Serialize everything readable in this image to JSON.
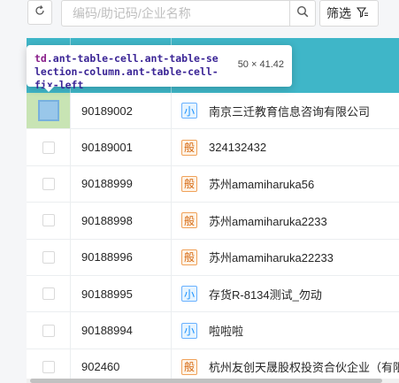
{
  "toolbar": {
    "search_placeholder": "编码/助记码/企业名称",
    "filter_label": "筛选",
    "icons": {
      "refresh": "refresh-icon",
      "search": "search-icon",
      "filter": "filter-icon"
    }
  },
  "table": {
    "header_color": "#3fb6c8",
    "rows": [
      {
        "code": "90189002",
        "tag": "小",
        "tag_type": "small",
        "name": "南京三迁教育信息咨询有限公司",
        "highlighted": true
      },
      {
        "code": "90189001",
        "tag": "般",
        "tag_type": "general",
        "name": "324132432"
      },
      {
        "code": "90188999",
        "tag": "般",
        "tag_type": "general",
        "name": "苏州amamiharuka56"
      },
      {
        "code": "90188998",
        "tag": "般",
        "tag_type": "general",
        "name": "苏州amamiharuka2233"
      },
      {
        "code": "90188996",
        "tag": "般",
        "tag_type": "general",
        "name": "苏州amamiharuka22233"
      },
      {
        "code": "90188995",
        "tag": "小",
        "tag_type": "small",
        "name": "存货R-8134测试_勿动"
      },
      {
        "code": "90188994",
        "tag": "小",
        "tag_type": "small",
        "name": "啦啦啦"
      },
      {
        "code": "902460",
        "tag": "般",
        "tag_type": "general",
        "name": "杭州友创天晟股权投资合伙企业（有限"
      }
    ]
  },
  "tooltip": {
    "element_tag": "td",
    "element_classes": ".ant-table-cell.ant-table-selection-column.ant-table-cell-fix-left",
    "size": "50 × 41.42"
  }
}
